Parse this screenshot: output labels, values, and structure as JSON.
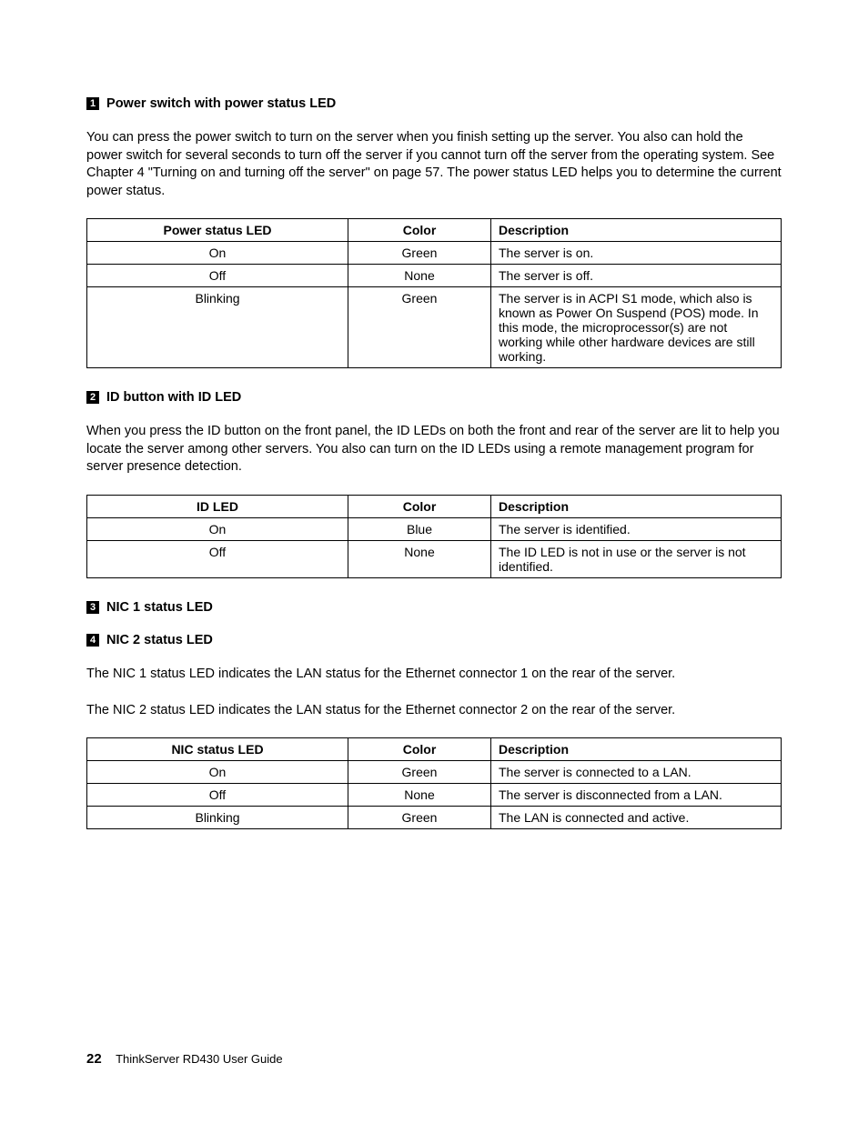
{
  "section1": {
    "num": "1",
    "title": "Power switch with power status LED",
    "para": "You can press the power switch to turn on the server when you finish setting up the server. You also can hold the power switch for several seconds to turn off the server if you cannot turn off the server from the operating system. See Chapter 4 \"Turning on and turning off the server\" on page 57. The power status LED helps you to determine the current power status.",
    "table": {
      "headers": [
        "Power status LED",
        "Color",
        "Description"
      ],
      "rows": [
        [
          "On",
          "Green",
          "The server is on."
        ],
        [
          "Off",
          "None",
          "The server is off."
        ],
        [
          "Blinking",
          "Green",
          "The server is in ACPI S1 mode, which also is known as Power On Suspend (POS) mode. In this mode, the microprocessor(s) are not working while other hardware devices are still working."
        ]
      ]
    }
  },
  "section2": {
    "num": "2",
    "title": "ID button with ID LED",
    "para": "When you press the ID button on the front panel, the ID LEDs on both the front and rear of the server are lit to help you locate the server among other servers. You also can turn on the ID LEDs using a remote management program for server presence detection.",
    "table": {
      "headers": [
        "ID LED",
        "Color",
        "Description"
      ],
      "rows": [
        [
          "On",
          "Blue",
          "The server is identified."
        ],
        [
          "Off",
          "None",
          "The ID LED is not in use or the server is not identified."
        ]
      ]
    }
  },
  "section3": {
    "num": "3",
    "title": "NIC 1 status LED"
  },
  "section4": {
    "num": "4",
    "title": "NIC 2 status LED",
    "para1": "The NIC 1 status LED indicates the LAN status for the Ethernet connector 1 on the rear of the server.",
    "para2": "The NIC 2 status LED indicates the LAN status for the Ethernet connector 2 on the rear of the server.",
    "table": {
      "headers": [
        "NIC status LED",
        "Color",
        "Description"
      ],
      "rows": [
        [
          "On",
          "Green",
          "The server is connected to a LAN."
        ],
        [
          "Off",
          "None",
          "The server is disconnected from a LAN."
        ],
        [
          "Blinking",
          "Green",
          "The LAN is connected and active."
        ]
      ]
    }
  },
  "footer": {
    "page": "22",
    "doc": "ThinkServer RD430 User Guide"
  }
}
